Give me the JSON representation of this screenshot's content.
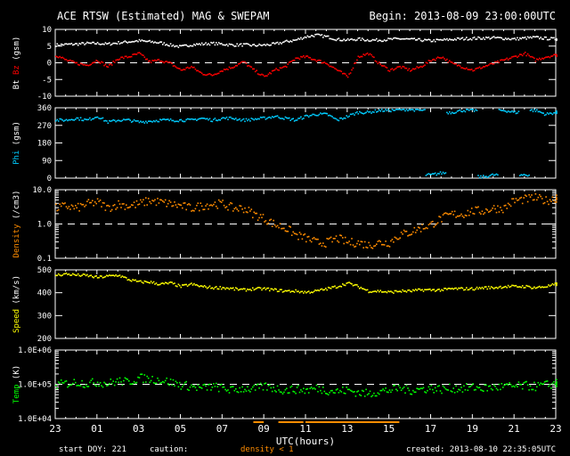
{
  "title": "ACE RTSW (Estimated) MAG & SWEPAM",
  "begin": "Begin: 2013-08-09 23:00:00UTC",
  "footer": {
    "start_doy": "start DOY: 221",
    "caution": "caution:",
    "caution_note": "density < 1",
    "created": "created: 2013-08-10 22:35:05UTC"
  },
  "colors": {
    "bt": "#ffffff",
    "bz": "#ff0000",
    "phi": "#00ccff",
    "density": "#ff8c00",
    "speed": "#ffff00",
    "temp": "#00ff00"
  },
  "chart_data": {
    "type": "scatter",
    "xlabel": "UTC(hours)",
    "x_hours_from_start": [
      0,
      0.5,
      1,
      1.5,
      2,
      2.5,
      3,
      3.5,
      4,
      4.5,
      5,
      5.5,
      6,
      6.5,
      7,
      7.5,
      8,
      8.5,
      9,
      9.5,
      10,
      10.5,
      11,
      11.5,
      12,
      12.5,
      13,
      13.5,
      14,
      14.5,
      15,
      15.5,
      16,
      16.5,
      17,
      17.5,
      18,
      18.5,
      19,
      19.5,
      20,
      20.5,
      21,
      21.5,
      22,
      22.5,
      23,
      23.5,
      24
    ],
    "xticks": [
      "23",
      "01",
      "03",
      "05",
      "07",
      "09",
      "11",
      "13",
      "15",
      "17",
      "19",
      "21",
      "23"
    ],
    "caution_ranges_hours": [
      [
        9.5,
        10
      ],
      [
        10.7,
        11.9
      ],
      [
        12,
        16.5
      ]
    ],
    "panels": [
      {
        "id": "mag",
        "label": [
          "Bt ",
          "Bz",
          " (gsm)"
        ],
        "label_colors": [
          "bt",
          "bz",
          "bt"
        ],
        "scale": "linear",
        "ylim": [
          -10,
          10
        ],
        "ticks": [
          "10",
          "5",
          "0",
          "-5",
          "-10"
        ],
        "tick_values": [
          10,
          5,
          0,
          -5,
          -10
        ],
        "ref": 0,
        "series": [
          {
            "name": "Bt",
            "color": "bt",
            "values": [
              5.5,
              5.7,
              5.8,
              6,
              6,
              5.8,
              6.2,
              6.5,
              6.8,
              6.5,
              6.2,
              5.5,
              5,
              5.6,
              5.8,
              6,
              5.8,
              5.5,
              5.6,
              5.4,
              5.5,
              5.8,
              6.5,
              7,
              8,
              8.5,
              8,
              7.2,
              7,
              7.3,
              7,
              7,
              7.2,
              7.4,
              7.2,
              7,
              6.8,
              7,
              7.2,
              7.4,
              7.5,
              7.6,
              7.7,
              7.5,
              7.3,
              7.6,
              7.8,
              7.5,
              7.3
            ]
          },
          {
            "name": "Bz",
            "color": "bz",
            "values": [
              2.5,
              1,
              0,
              -0.5,
              1,
              -1,
              1.5,
              2,
              3,
              0.5,
              1,
              0,
              -2,
              -1,
              -3,
              -3.5,
              -2,
              -1,
              0.5,
              -2,
              -4,
              -2,
              -1,
              1.5,
              2,
              1,
              0,
              -2,
              -4,
              2,
              3,
              0,
              -2,
              -1,
              -2,
              -1,
              1,
              2,
              0,
              -1,
              -2,
              -1,
              0,
              1,
              2,
              3,
              1,
              2,
              2.5
            ]
          }
        ]
      },
      {
        "id": "phi",
        "label": [
          "Phi",
          " (gsm)"
        ],
        "label_colors": [
          "phi",
          "bt"
        ],
        "scale": "linear",
        "ylim": [
          0,
          360
        ],
        "ticks": [
          "360",
          "270",
          "180",
          "90",
          "0"
        ],
        "tick_values": [
          360,
          270,
          180,
          90,
          0
        ],
        "series": [
          {
            "name": "Phi",
            "color": "phi",
            "values": [
              300,
              300,
              310,
              300,
              320,
              290,
              300,
              300,
              290,
              295,
              300,
              300,
              300,
              300,
              310,
              300,
              310,
              310,
              300,
              305,
              310,
              320,
              310,
              300,
              320,
              330,
              330,
              300,
              320,
              340,
              340,
              350,
              350,
              355,
              355,
              350,
              20,
              30,
              340,
              350,
              350,
              10,
              20,
              350,
              340,
              20,
              350,
              330,
              340
            ]
          }
        ]
      },
      {
        "id": "density",
        "label": [
          "Density",
          " (/cm3)"
        ],
        "label_colors": [
          "density",
          "bt"
        ],
        "scale": "log",
        "ylim": [
          0.1,
          10
        ],
        "ticks": [
          "10.0",
          "1.0",
          "0.1"
        ],
        "tick_values": [
          10,
          1,
          0.1
        ],
        "ref": 1,
        "series": [
          {
            "name": "Density",
            "color": "density",
            "values": [
              3,
              3.5,
              3,
              4,
              4.5,
              3,
              4,
              3.5,
              4,
              5,
              4.5,
              4,
              3.5,
              3,
              3.5,
              4,
              4,
              3,
              3,
              2,
              1.5,
              1,
              0.8,
              0.5,
              0.4,
              0.3,
              0.3,
              0.4,
              0.3,
              0.3,
              0.25,
              0.3,
              0.3,
              0.5,
              0.6,
              0.8,
              1,
              1.5,
              2,
              2,
              2.5,
              2.5,
              3,
              3,
              5,
              5.5,
              6,
              5,
              6
            ]
          }
        ]
      },
      {
        "id": "speed",
        "label": [
          "Speed",
          " (km/s)"
        ],
        "label_colors": [
          "speed",
          "bt"
        ],
        "scale": "linear",
        "ylim": [
          200,
          500
        ],
        "ticks": [
          "500",
          "400",
          "300",
          "200"
        ],
        "tick_values": [
          500,
          400,
          300,
          200
        ],
        "series": [
          {
            "name": "Speed",
            "color": "speed",
            "values": [
              480,
              485,
              480,
              478,
              470,
              475,
              480,
              460,
              450,
              450,
              440,
              445,
              430,
              440,
              430,
              425,
              425,
              420,
              415,
              420,
              420,
              415,
              410,
              410,
              405,
              410,
              420,
              430,
              445,
              430,
              410,
              410,
              405,
              410,
              410,
              415,
              415,
              415,
              420,
              420,
              420,
              425,
              425,
              430,
              430,
              430,
              425,
              430,
              440
            ]
          }
        ]
      },
      {
        "id": "temp",
        "label": [
          "Temp",
          " (K)"
        ],
        "label_colors": [
          "temp",
          "bt"
        ],
        "scale": "log",
        "ylim": [
          10000,
          1000000
        ],
        "ticks": [
          "1.0E+06",
          "1.0E+05",
          "1.0E+04"
        ],
        "tick_values": [
          1000000,
          100000,
          10000
        ],
        "ref": 100000,
        "series": [
          {
            "name": "Temp",
            "color": "temp",
            "values": [
              100000,
              110000,
              120000,
              110000,
              120000,
              110000,
              130000,
              120000,
              160000,
              150000,
              140000,
              120000,
              100000,
              90000,
              80000,
              90000,
              80000,
              70000,
              80000,
              75000,
              90000,
              80000,
              70000,
              75000,
              70000,
              80000,
              70000,
              65000,
              70000,
              60000,
              55000,
              65000,
              70000,
              80000,
              70000,
              75000,
              80000,
              75000,
              80000,
              80000,
              85000,
              80000,
              85000,
              90000,
              90000,
              95000,
              90000,
              100000,
              110000
            ]
          }
        ]
      }
    ]
  }
}
